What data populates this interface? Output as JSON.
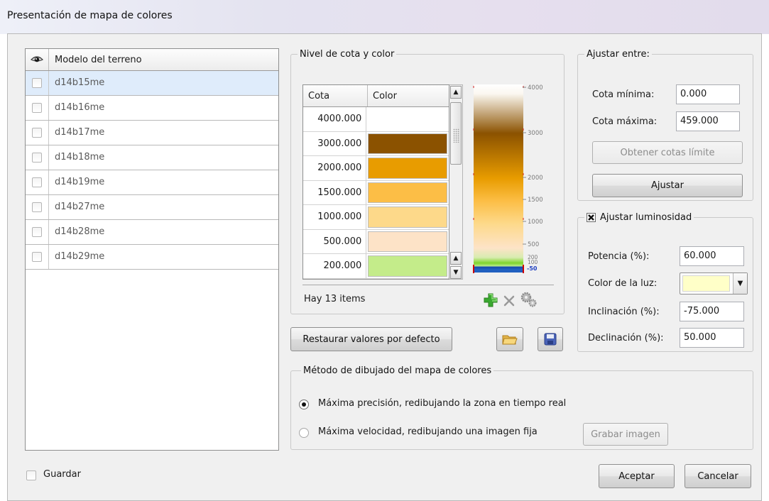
{
  "window": {
    "title": "Presentación de mapa de colores"
  },
  "terrain": {
    "column_header": "Modelo del terreno",
    "rows": [
      "d14b15me",
      "d14b16me",
      "d14b17me",
      "d14b18me",
      "d14b19me",
      "d14b27me",
      "d14b28me",
      "d14b29me"
    ]
  },
  "level": {
    "legend": "Nivel de cota y color",
    "col_cota": "Cota",
    "col_color": "Color",
    "rows": [
      {
        "cota": "4000.000",
        "color": "#ffffff"
      },
      {
        "cota": "3000.000",
        "color": "#8b5200"
      },
      {
        "cota": "2000.000",
        "color": "#e89c00"
      },
      {
        "cota": "1500.000",
        "color": "#fcbe46"
      },
      {
        "cota": "1000.000",
        "color": "#fdd98a"
      },
      {
        "cota": "500.000",
        "color": "#fde3c7"
      },
      {
        "cota": "200.000",
        "color": "#c4ec8a"
      }
    ],
    "items_text": "Hay 13 items",
    "scale_labels": [
      "4000",
      "3000",
      "2000",
      "1500",
      "1000",
      "500",
      "200",
      "100",
      "-50"
    ]
  },
  "ajustar_entre": {
    "legend": "Ajustar entre:",
    "min_label": "Cota mínima:",
    "min_value": "0.000",
    "max_label": "Cota máxima:",
    "max_value": "459.000",
    "obtener_button": "Obtener cotas límite",
    "ajustar_button": "Ajustar"
  },
  "luminosidad": {
    "legend": "Ajustar luminosidad",
    "checked": true,
    "potencia_label": "Potencia (%):",
    "potencia_value": "60.000",
    "color_luz_label": "Color de la luz:",
    "color_luz": "#ffffc8",
    "inclinacion_label": "Inclinación (%):",
    "inclinacion_value": "-75.000",
    "declinacion_label": "Declinación (%):",
    "declinacion_value": "50.000"
  },
  "restaurar_button": "Restaurar valores por defecto",
  "metodo": {
    "legend": "Método de dibujado del mapa de colores",
    "option1": "Máxima precisión, redibujando la zona en tiempo real",
    "option2": "Máxima velocidad, redibujando una imagen fija",
    "grabar_button": "Grabar imagen",
    "selected": "option1"
  },
  "guardar_label": "Guardar",
  "aceptar_button": "Aceptar",
  "cancelar_button": "Cancelar"
}
